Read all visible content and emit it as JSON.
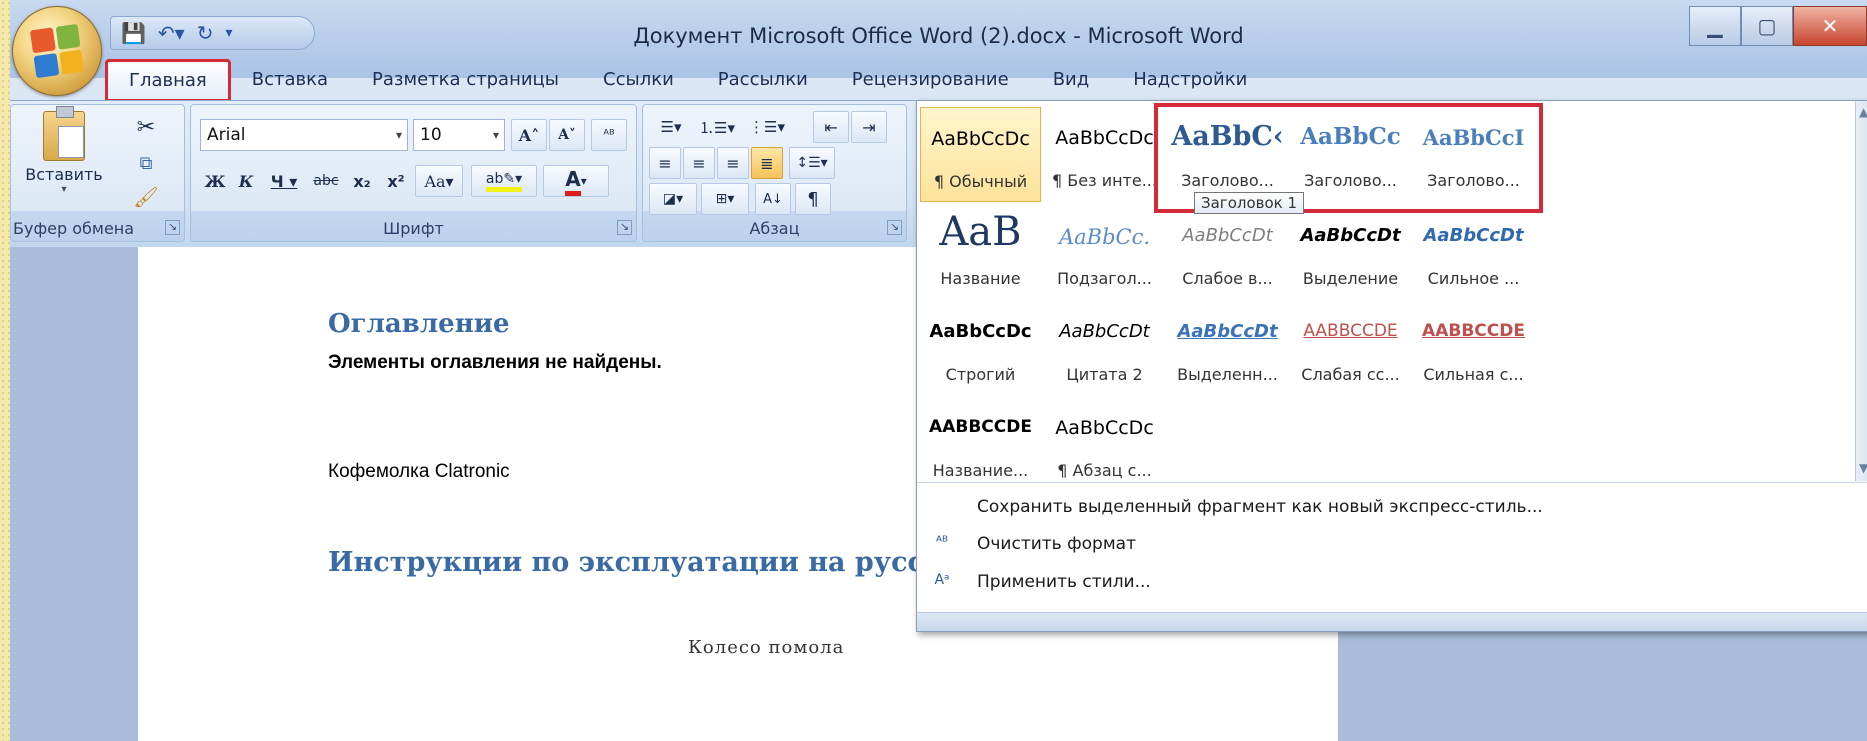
{
  "window": {
    "title": "Документ Microsoft Office Word (2).docx - Microsoft Word"
  },
  "quick_access": {
    "icons": [
      "save-icon",
      "undo-icon",
      "redo-icon",
      "customize-icon"
    ]
  },
  "tabs": [
    {
      "label": "Главная",
      "active": true
    },
    {
      "label": "Вставка"
    },
    {
      "label": "Разметка страницы"
    },
    {
      "label": "Ссылки"
    },
    {
      "label": "Рассылки"
    },
    {
      "label": "Рецензирование"
    },
    {
      "label": "Вид"
    },
    {
      "label": "Надстройки"
    }
  ],
  "ribbon": {
    "clipboard": {
      "paste_label": "Вставить",
      "group_label": "Буфер обмена"
    },
    "font": {
      "name": "Arial",
      "size": "10",
      "group_label": "Шрифт"
    },
    "paragraph": {
      "group_label": "Абзац"
    }
  },
  "document": {
    "toc_title": "Оглавление",
    "toc_empty": "Элементы оглавления не найдены.",
    "product": "Кофемолка Clatronic",
    "heading": "Инструкции по эксплуатации на русско",
    "caption": "Колесо помола"
  },
  "styles_gallery": {
    "tiles": [
      {
        "sample": "AaBbCcDc",
        "label": "¶ Обычный",
        "selected": true
      },
      {
        "sample": "AaBbCcDc",
        "label": "¶ Без инте..."
      },
      {
        "sample": "AaBbC‹",
        "label": "Заголово..."
      },
      {
        "sample": "AaBbCc",
        "label": "Заголово..."
      },
      {
        "sample": "AaBbCcI",
        "label": "Заголово..."
      },
      {
        "sample": "AaB",
        "label": "Название"
      },
      {
        "sample": "AaBbCc.",
        "label": "Подзагол..."
      },
      {
        "sample": "AaBbCcDt",
        "label": "Слабое в..."
      },
      {
        "sample": "AaBbCcDt",
        "label": "Выделение"
      },
      {
        "sample": "AaBbCcDt",
        "label": "Сильное ..."
      },
      {
        "sample": "AaBbCcDc",
        "label": "Строгий"
      },
      {
        "sample": "AaBbCcDt",
        "label": "Цитата 2"
      },
      {
        "sample": "AaBbCcDt",
        "label": "Выделенн..."
      },
      {
        "sample": "AABBCCDE",
        "label": "Слабая сс..."
      },
      {
        "sample": "AABBCCDE",
        "label": "Сильная с..."
      },
      {
        "sample": "AABBCCDE",
        "label": "Название..."
      },
      {
        "sample": "AaBbCcDc",
        "label": "¶ Абзац с..."
      }
    ],
    "tooltip": "Заголовок 1",
    "menu": {
      "save_as_style": "Сохранить выделенный фрагмент как новый экспресс-стиль...",
      "clear_format": "Очистить формат",
      "apply_styles": "Применить стили..."
    }
  },
  "colors": {
    "highlight_red": "#d42b3a",
    "heading_blue": "#3a6aa3",
    "ribbon_bg": "#dbe7f5"
  }
}
